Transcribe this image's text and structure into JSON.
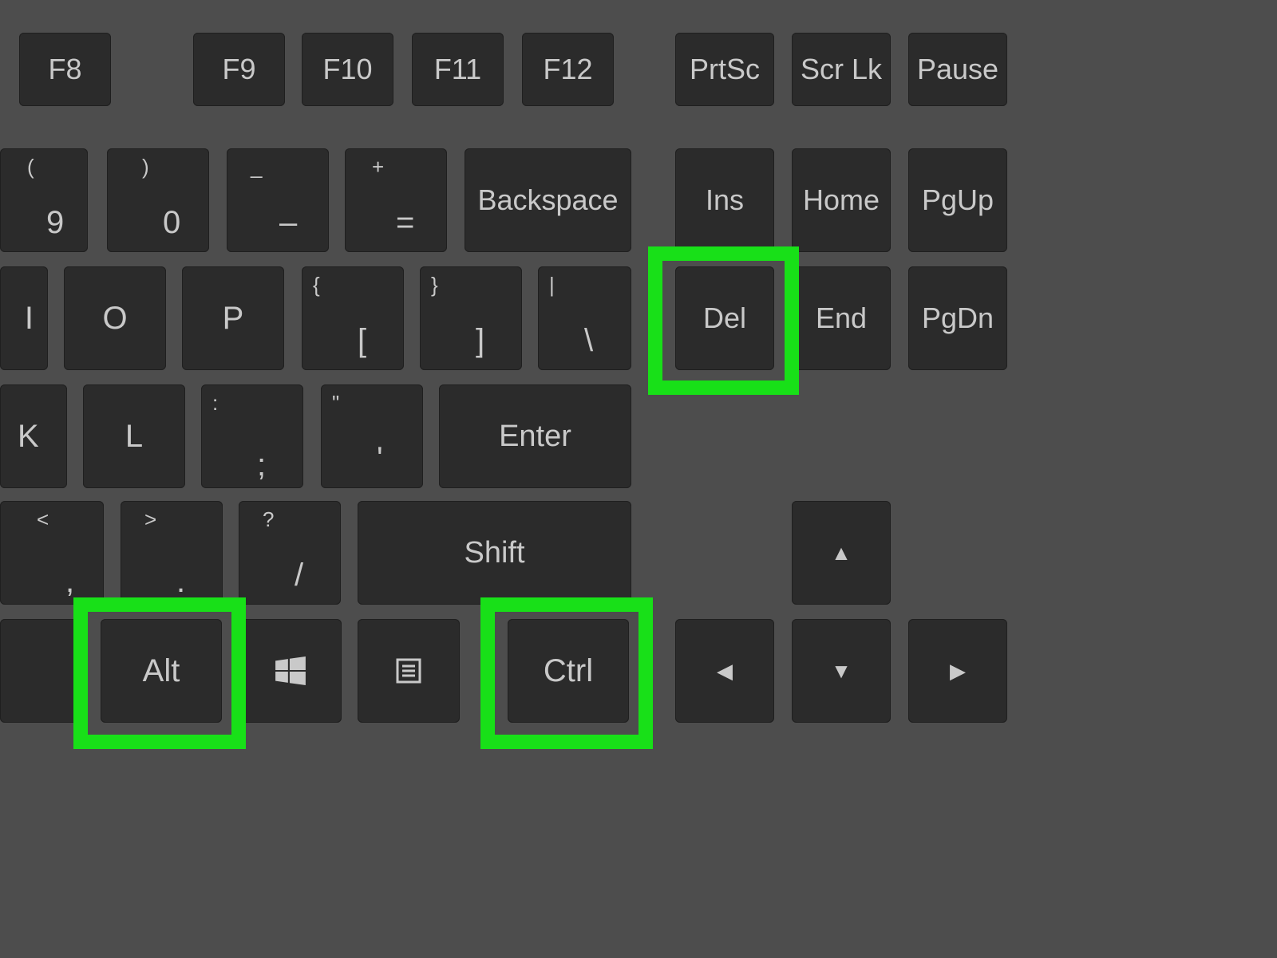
{
  "topRow": {
    "f8": "F8",
    "f9": "F9",
    "f10": "F10",
    "f11": "F11",
    "f12": "F12",
    "prtsc": "PrtSc",
    "scrlk": "Scr Lk",
    "pause": "Pause"
  },
  "numRow": {
    "nine": {
      "upper": "(",
      "lower": "9"
    },
    "zero": {
      "upper": ")",
      "lower": "0"
    },
    "minus": {
      "upper": "_",
      "lower": "–"
    },
    "equals": {
      "upper": "+",
      "lower": "="
    },
    "backspace": "Backspace",
    "ins": "Ins",
    "home": "Home",
    "pgup": "PgUp"
  },
  "rowQ": {
    "i": "I",
    "o": "O",
    "p": "P",
    "lbracket": {
      "upper": "{",
      "lower": "["
    },
    "rbracket": {
      "upper": "}",
      "lower": "]"
    },
    "backslash": {
      "upper": "|",
      "lower": "\\"
    },
    "del": "Del",
    "end": "End",
    "pgdn": "PgDn"
  },
  "rowA": {
    "k": "K",
    "l": "L",
    "semicolon": {
      "upper": ":",
      "lower": ";"
    },
    "quote": {
      "upper": "\"",
      "lower": "'"
    },
    "enter": "Enter"
  },
  "rowZ": {
    "comma": {
      "upper": "<",
      "lower": ","
    },
    "period": {
      "upper": ">",
      "lower": "."
    },
    "slash": {
      "upper": "?",
      "lower": "/"
    },
    "shift": "Shift"
  },
  "bottom": {
    "alt": "Alt",
    "ctrl": "Ctrl"
  },
  "arrows": {
    "up": "▲",
    "left": "◀",
    "down": "▼",
    "right": "▶"
  },
  "highlighted_keys": [
    "del",
    "alt",
    "ctrl"
  ]
}
